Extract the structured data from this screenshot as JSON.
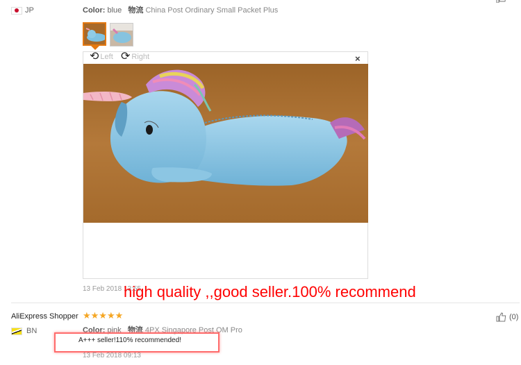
{
  "review1": {
    "country_code": "JP",
    "color_label": "Color:",
    "color_value": "blue",
    "shipping_label": "物流",
    "shipping_value": "China Post Ordinary Small Packet Plus",
    "viewer": {
      "rotate_left": "Left",
      "rotate_right": "Right",
      "close": "×"
    },
    "date": "13 Feb 2018 13:55"
  },
  "overlay_caption": "high quality ,,good seller.100% recommend",
  "review2": {
    "user": "AliExpress Shopper",
    "stars": "★★★★★",
    "country_code": "BN",
    "color_label": "Color:",
    "color_value": "pink",
    "shipping_label": "物流",
    "shipping_value": "4PX Singapore Post OM Pro",
    "feedback": "A+++ seller!110% recommended!",
    "date": "13 Feb 2018 09:13",
    "helpful_count": "(0)"
  },
  "colors": {
    "accent": "#e47911",
    "stars": "#f5a623",
    "overlay": "#ff0000"
  }
}
